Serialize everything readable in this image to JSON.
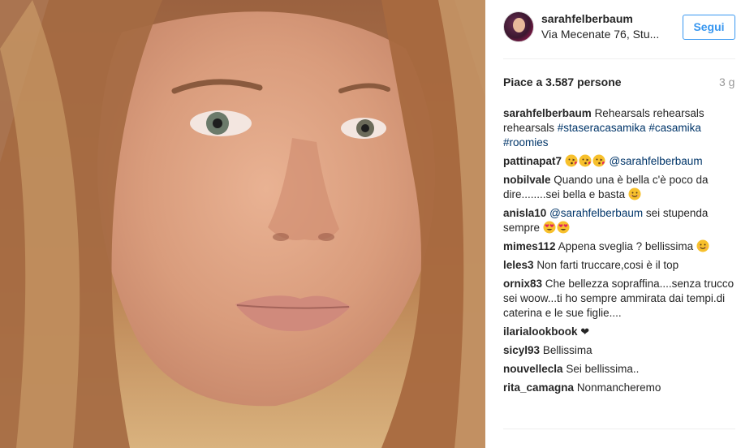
{
  "post": {
    "username": "sarahfelberbaum",
    "location": "Via Mecenate 76, Stu...",
    "follow_label": "Segui",
    "likes_text": "Piace a 3.587 persone",
    "time_ago": "3 g"
  },
  "caption": {
    "user": "sarahfelberbaum",
    "text": "Rehearsals rehearsals rehearsals",
    "hashtags": [
      "#staseracasamika",
      "#casamika",
      "#roomies"
    ]
  },
  "comments": [
    {
      "user": "pattinapat7",
      "mention": "@sarahfelberbaum",
      "emojis": [
        "kiss-face",
        "kiss-face",
        "kiss-face"
      ]
    },
    {
      "user": "nobilvale",
      "text": "Quando una è bella c'è poco da dire........sei bella e basta",
      "emojis": [
        "smile-face"
      ]
    },
    {
      "user": "anisla10",
      "mention": "@sarahfelberbaum",
      "text": "sei stupenda sempre",
      "emojis": [
        "heart-eyes-face",
        "heart-eyes-face"
      ]
    },
    {
      "user": "mimes112",
      "text": "Appena sveglia ? bellissima",
      "emojis": [
        "smile-face"
      ]
    },
    {
      "user": "leles3",
      "text": "Non farti truccare,cosi è il top"
    },
    {
      "user": "ornix83",
      "text": "Che bellezza sopraffina....senza trucco sei woow...ti ho sempre ammirata dai tempi.di caterina e le sue figlie...."
    },
    {
      "user": "ilarialookbook",
      "text": "❤"
    },
    {
      "user": "sicyl93",
      "text": "Bellissima"
    },
    {
      "user": "nouvellecla",
      "text": "Sei bellissima.."
    },
    {
      "user": "rita_camagna",
      "text": "Nonmancheremo"
    }
  ],
  "colors": {
    "accent": "#3897f0",
    "hashtag": "#003569",
    "muted": "#999999",
    "text": "#262626"
  }
}
